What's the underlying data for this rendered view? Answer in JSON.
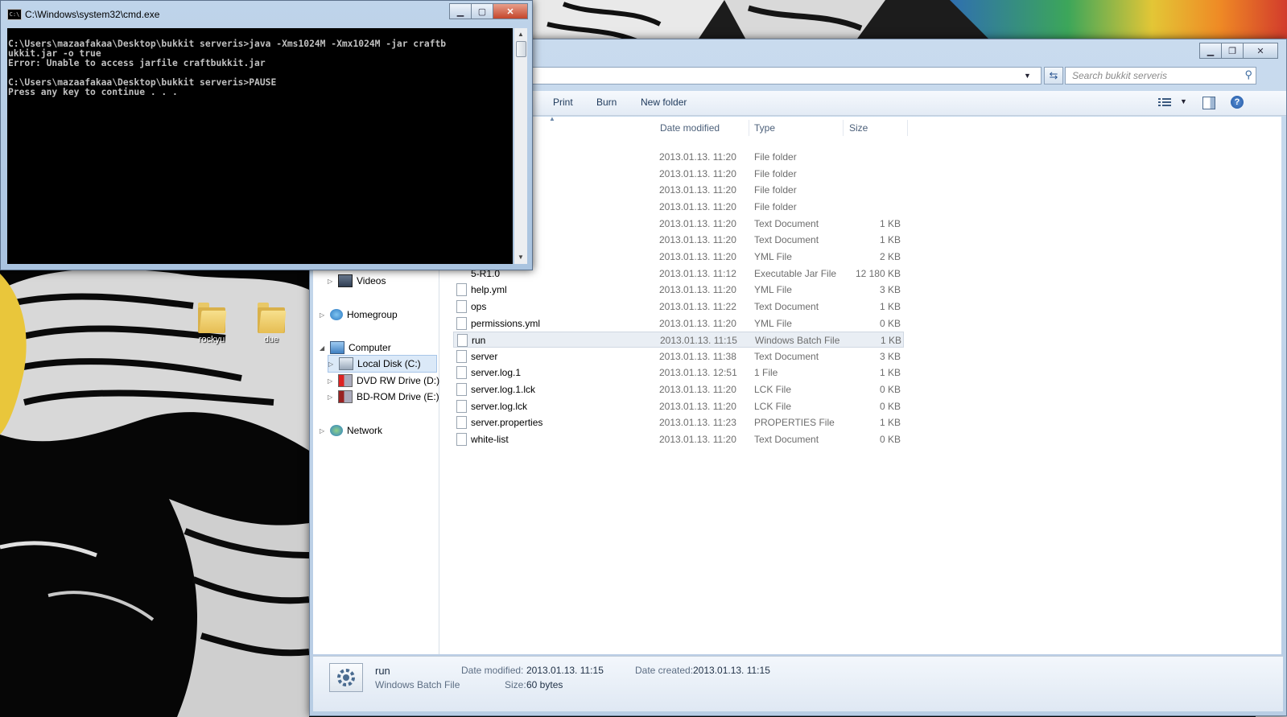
{
  "desktop": {
    "icons": [
      {
        "label": "rockyu"
      },
      {
        "label": "due"
      }
    ]
  },
  "cmd": {
    "title": "C:\\Windows\\system32\\cmd.exe",
    "icon_text": "C:\\",
    "lines": [
      "",
      "C:\\Users\\mazaafakaa\\Desktop\\bukkit serveris>java -Xms1024M -Xmx1024M -jar craftb",
      "ukkit.jar -o true",
      "Error: Unable to access jarfile craftbukkit.jar",
      "",
      "C:\\Users\\mazaafakaa\\Desktop\\bukkit serveris>PAUSE",
      "Press any key to continue . . ."
    ]
  },
  "explorer": {
    "search_placeholder": "Search bukkit serveris",
    "toolbar": {
      "print": "Print",
      "burn": "Burn",
      "new_folder": "New folder"
    },
    "nav": {
      "videos": "Videos",
      "homegroup": "Homegroup",
      "computer": "Computer",
      "local_disk": "Local Disk (C:)",
      "dvd": "DVD RW Drive (D:) G",
      "bdrom": "BD-ROM Drive (E:) N",
      "network": "Network"
    },
    "columns": {
      "date": "Date modified",
      "type": "Type",
      "size": "Size"
    },
    "rows": [
      {
        "name": "",
        "date": "2013.01.13. 11:20",
        "type": "File folder",
        "size": ""
      },
      {
        "name": "",
        "date": "2013.01.13. 11:20",
        "type": "File folder",
        "size": ""
      },
      {
        "name": "",
        "date": "2013.01.13. 11:20",
        "type": "File folder",
        "size": ""
      },
      {
        "name": "",
        "date": "2013.01.13. 11:20",
        "type": "File folder",
        "size": ""
      },
      {
        "name": "",
        "date": "2013.01.13. 11:20",
        "type": "Text Document",
        "size": "1 KB"
      },
      {
        "name": "",
        "date": "2013.01.13. 11:20",
        "type": "Text Document",
        "size": "1 KB"
      },
      {
        "name": "",
        "date": "2013.01.13. 11:20",
        "type": "YML File",
        "size": "2 KB"
      },
      {
        "name": "5-R1.0",
        "date": "2013.01.13. 11:12",
        "type": "Executable Jar File",
        "size": "12 180 KB"
      },
      {
        "name": "help.yml",
        "date": "2013.01.13. 11:20",
        "type": "YML File",
        "size": "3 KB"
      },
      {
        "name": "ops",
        "date": "2013.01.13. 11:22",
        "type": "Text Document",
        "size": "1 KB"
      },
      {
        "name": "permissions.yml",
        "date": "2013.01.13. 11:20",
        "type": "YML File",
        "size": "0 KB"
      },
      {
        "name": "run",
        "date": "2013.01.13. 11:15",
        "type": "Windows Batch File",
        "size": "1 KB"
      },
      {
        "name": "server",
        "date": "2013.01.13. 11:38",
        "type": "Text Document",
        "size": "3 KB"
      },
      {
        "name": "server.log.1",
        "date": "2013.01.13. 12:51",
        "type": "1 File",
        "size": "1 KB"
      },
      {
        "name": "server.log.1.lck",
        "date": "2013.01.13. 11:20",
        "type": "LCK File",
        "size": "0 KB"
      },
      {
        "name": "server.log.lck",
        "date": "2013.01.13. 11:20",
        "type": "LCK File",
        "size": "0 KB"
      },
      {
        "name": "server.properties",
        "date": "2013.01.13. 11:23",
        "type": "PROPERTIES File",
        "size": "1 KB"
      },
      {
        "name": "white-list",
        "date": "2013.01.13. 11:20",
        "type": "Text Document",
        "size": "0 KB"
      }
    ],
    "details": {
      "name": "run",
      "type": "Windows Batch File",
      "date_modified_label": "Date modified:",
      "date_modified": "2013.01.13. 11:15",
      "date_created_label": "Date created:",
      "date_created": "2013.01.13. 11:15",
      "size_label": "Size:",
      "size": "60 bytes"
    }
  }
}
